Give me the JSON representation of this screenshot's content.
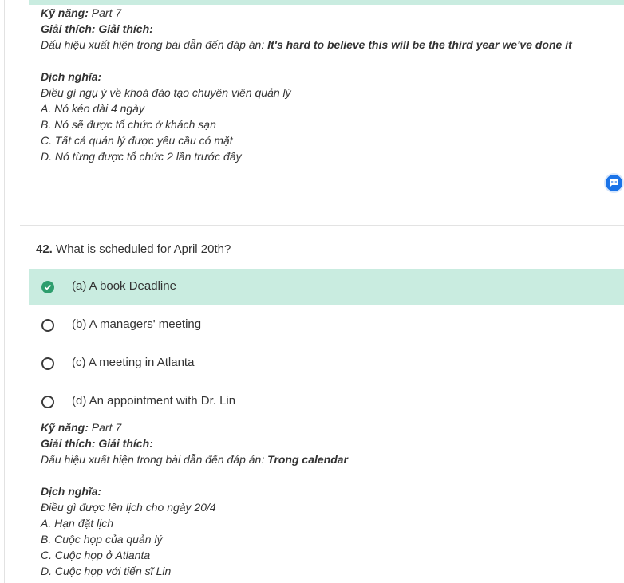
{
  "colors": {
    "correct_bg": "#c9ece0",
    "check_green": "#2e9e6e",
    "chat_blue": "#1a73e8"
  },
  "q41_explanation": {
    "skill_label": "Kỹ năng:",
    "skill_value": "Part 7",
    "expl_label": "Giải thích: Giải thích:",
    "signal_label": "Dấu hiệu xuất hiện trong bài dẫn đến đáp án:",
    "signal_value": "It's hard to believe this will be the third year we've done it",
    "translation_label": "Dịch nghĩa:",
    "lines": [
      "Điều gì ngụ ý về khoá đào tạo chuyên viên quản lý",
      "A. Nó kéo dài 4 ngày",
      "B. Nó sẽ được tổ chức ở khách sạn",
      "C. Tất cả quản lý được yêu cầu có mặt",
      "D. Nó từng được tổ chức 2 lần trước đây"
    ]
  },
  "chat_icon": "chat-bubble-icon",
  "q42": {
    "number": "42.",
    "text": "What is scheduled for April 20th?",
    "options": [
      {
        "label": "(a) A book Deadline",
        "correct": true
      },
      {
        "label": "(b) A managers' meeting",
        "correct": false
      },
      {
        "label": "(c) A meeting in Atlanta",
        "correct": false
      },
      {
        "label": "(d) An appointment with Dr. Lin",
        "correct": false
      }
    ]
  },
  "q42_explanation": {
    "skill_label": "Kỹ năng:",
    "skill_value": "Part 7",
    "expl_label": "Giải thích: Giải thích:",
    "signal_label": "Dấu hiệu xuất hiện trong bài dẫn đến đáp án:",
    "signal_value": "Trong calendar",
    "translation_label": "Dịch nghĩa:",
    "lines": [
      "Điều gì được lên lịch cho ngày 20/4",
      "A. Hạn đặt lịch",
      "B. Cuộc họp của quản lý",
      "C. Cuộc họp ở Atlanta",
      "D. Cuộc họp với tiến sĩ Lin"
    ]
  }
}
